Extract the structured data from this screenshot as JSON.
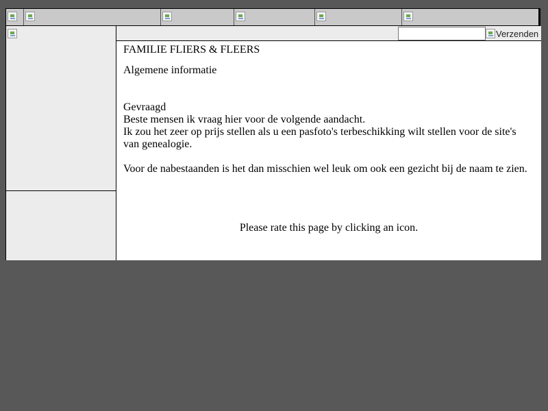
{
  "nav": {
    "buttons": [
      {
        "icon": "broken-image-icon"
      },
      {
        "icon": "broken-image-icon"
      },
      {
        "icon": "broken-image-icon"
      },
      {
        "icon": "broken-image-icon"
      },
      {
        "icon": "broken-image-icon"
      },
      {
        "icon": "broken-image-icon"
      }
    ]
  },
  "search": {
    "value": "",
    "placeholder": "",
    "submit_label": "Verzenden"
  },
  "content": {
    "title": "FAMILIE FLIERS & FLEERS",
    "subtitle": "Algemene informatie",
    "heading": "Gevraagd",
    "line1": "Beste mensen ik vraag hier voor de volgende aandacht.",
    "line2": "Ik zou het zeer op prijs stellen als u een pasfoto's terbeschikking wilt stellen voor de site's van genealogie.",
    "line3": "Voor de nabestaanden is het dan misschien wel leuk om ook een gezicht bij de naam te zien."
  },
  "rating": {
    "text": "Please rate this page by clicking an icon."
  },
  "colors": {
    "page_background": "#585858",
    "nav_background": "#c9c9c9",
    "panel_background": "#ececec",
    "content_background": "#ffffff"
  }
}
